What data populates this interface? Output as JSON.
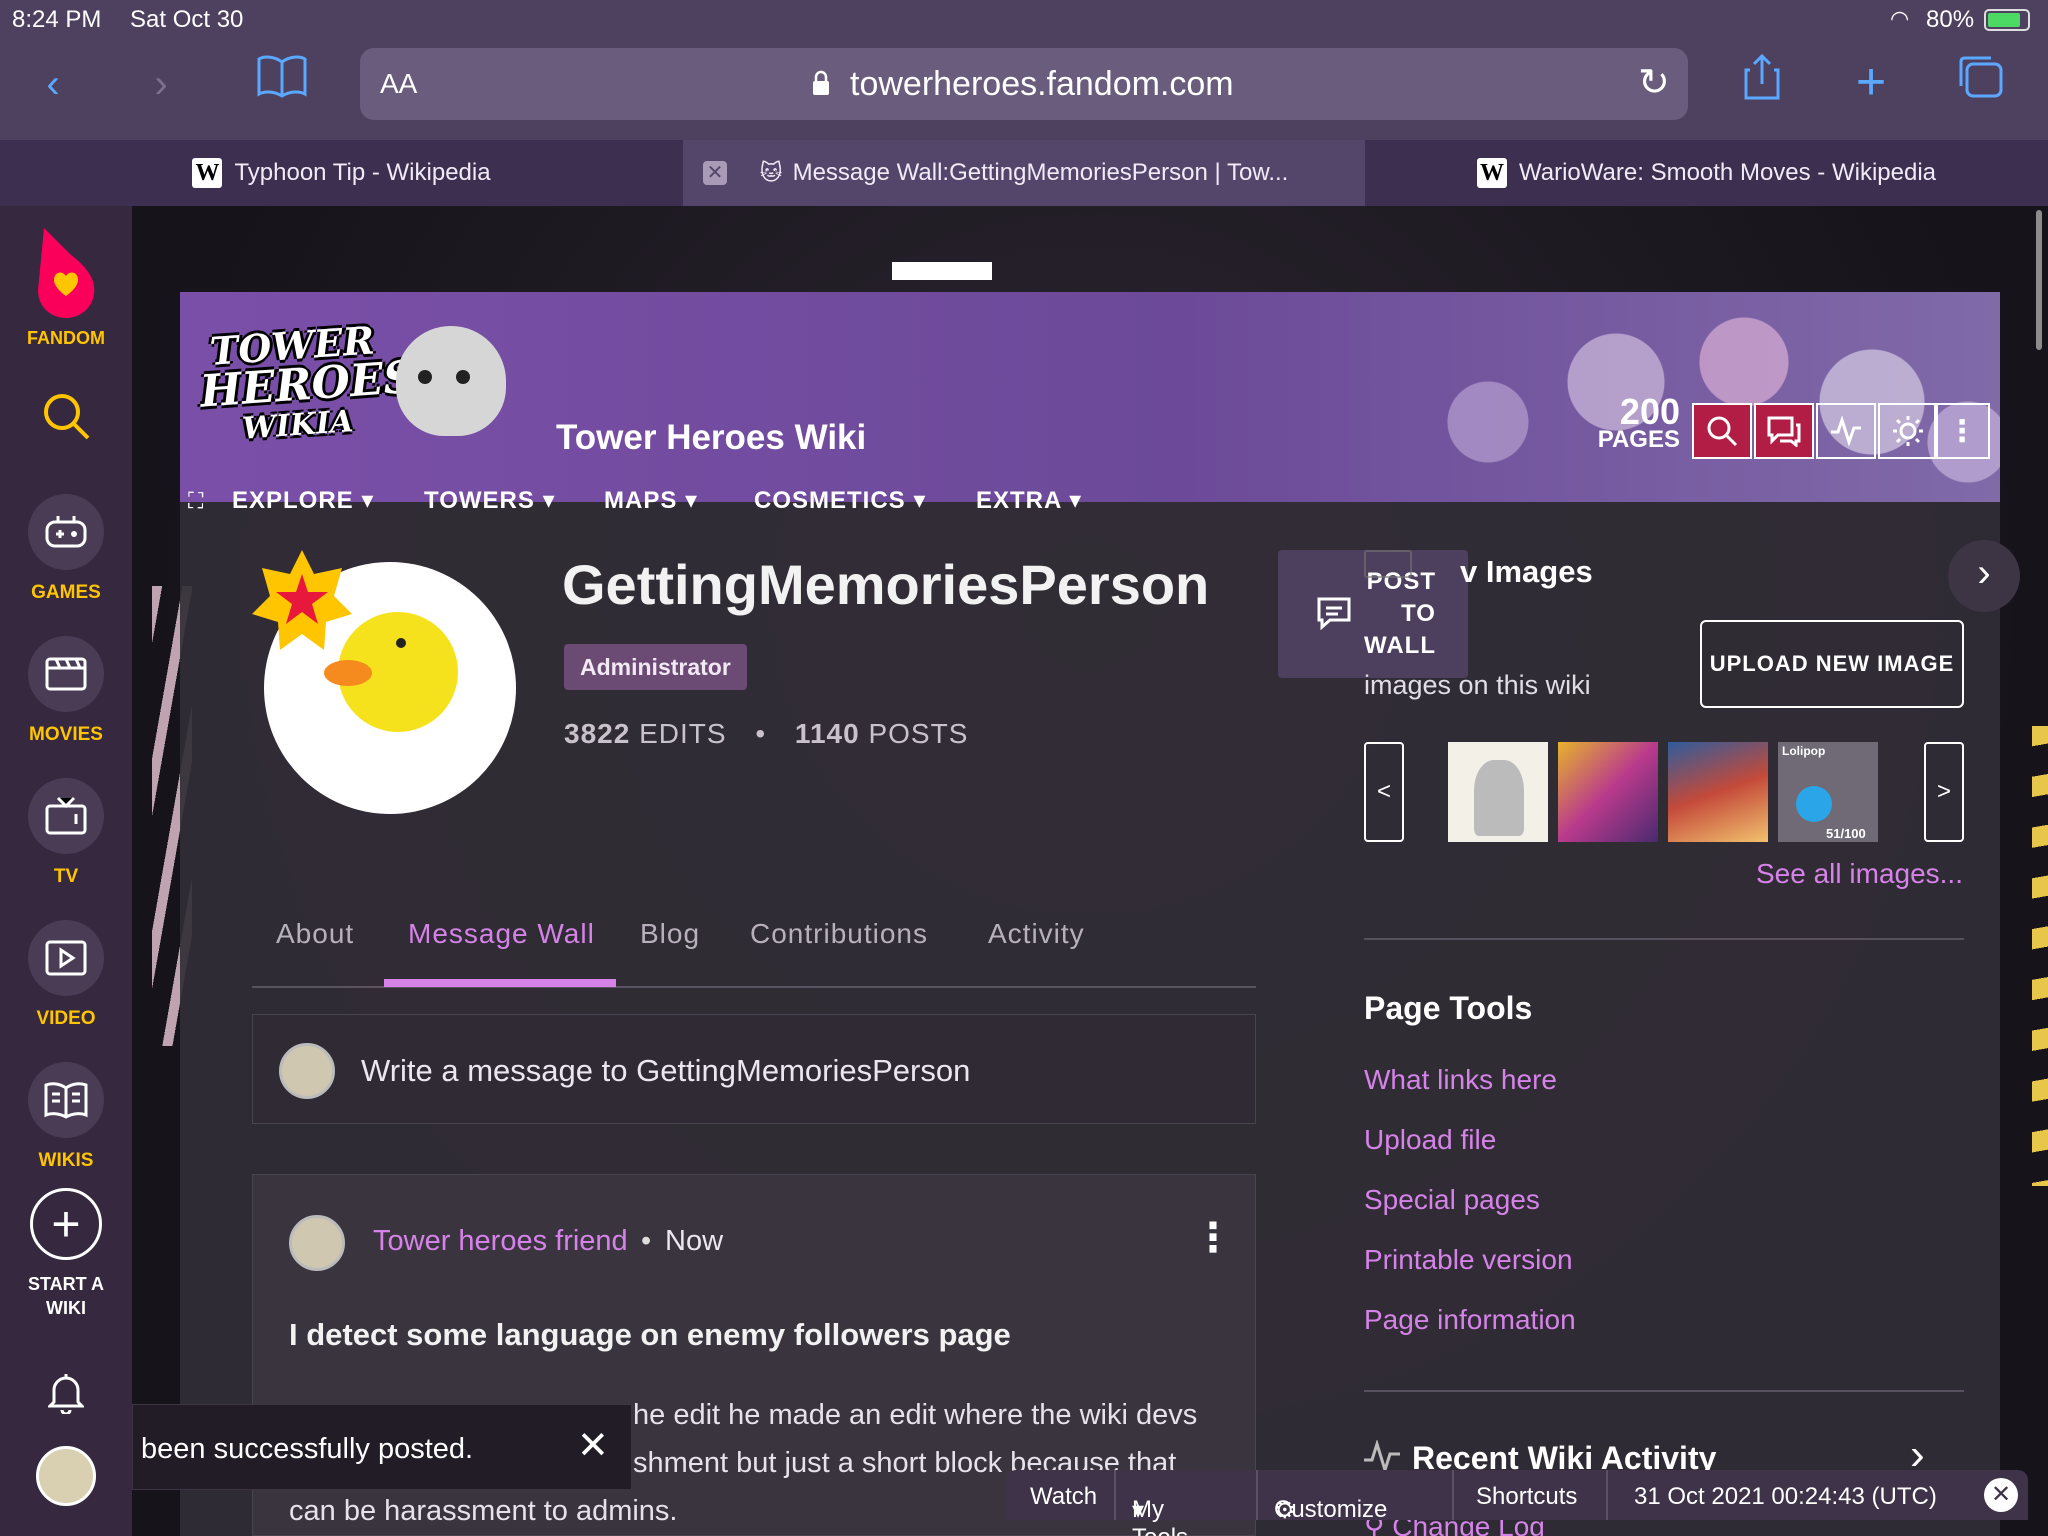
{
  "status": {
    "time": "8:24 PM",
    "date": "Sat Oct 30",
    "battery": "80%"
  },
  "browser": {
    "text_size_label": "AA",
    "url": "towerheroes.fandom.com",
    "tabs": [
      {
        "label": "Typhoon Tip - Wikipedia"
      },
      {
        "label": "Message Wall:GettingMemoriesPerson | Tow..."
      },
      {
        "label": "WarioWare: Smooth Moves - Wikipedia"
      }
    ]
  },
  "sidebar": {
    "brand": "FANDOM",
    "items": [
      {
        "label": "GAMES"
      },
      {
        "label": "MOVIES"
      },
      {
        "label": "TV"
      },
      {
        "label": "VIDEO"
      },
      {
        "label": "WIKIS"
      },
      {
        "label": "START A WIKI"
      }
    ]
  },
  "wiki": {
    "logo_text": [
      "TOWER",
      "HEROES",
      "WIKIA"
    ],
    "name": "Tower Heroes Wiki",
    "page_count": "200",
    "pages_label": "PAGES",
    "nav": [
      "EXPLORE",
      "TOWERS",
      "MAPS",
      "COSMETICS",
      "EXTRA"
    ]
  },
  "profile": {
    "username": "GettingMemoriesPerson",
    "role": "Administrator",
    "edits_count": "3822",
    "edits_label": "EDITS",
    "posts_count": "1140",
    "posts_label": "POSTS",
    "tabs": [
      "About",
      "Message Wall",
      "Blog",
      "Contributions",
      "Activity"
    ],
    "active_tab": "Message Wall"
  },
  "compose": {
    "placeholder": "Write a message to GettingMemoriesPerson"
  },
  "post_to_wall": {
    "lines": [
      "POST",
      "TO",
      "WALL"
    ]
  },
  "message": {
    "author": "Tower heroes friend",
    "time": "Now",
    "title": "I detect some language on enemy followers page",
    "line1_left": "",
    "line1": "he edit he made an edit where the wiki devs",
    "line2": "shment but just a short block because that",
    "line3": "can be harassment  to admins."
  },
  "toast": {
    "text": "been successfully posted."
  },
  "images_panel": {
    "title_fragment": "v Images",
    "subtitle_fragment": "images on this wiki",
    "upload_button": "UPLOAD NEW IMAGE",
    "prev": "<",
    "next": ">",
    "thumb4_title": "Lolipop",
    "thumb4_count": "51/100",
    "see_all": "See all images..."
  },
  "page_tools": {
    "title": "Page Tools",
    "links": [
      "What links here",
      "Upload file",
      "Special pages",
      "Printable version",
      "Page information"
    ]
  },
  "recent_activity": {
    "title": "Recent Wiki Activity",
    "first_item": "Change Log"
  },
  "bottom_bar": {
    "watch": "Watch",
    "my_tools": "My Tools",
    "customize": "Customize",
    "shortcuts": "Shortcuts",
    "timestamp": "31 Oct 2021 00:24:43 (UTC)"
  },
  "colors": {
    "accent": "#d583e8",
    "fandom_yellow": "#ffc500",
    "header_purple": "#6c4a99",
    "ios_blue": "#5aa8ff"
  }
}
